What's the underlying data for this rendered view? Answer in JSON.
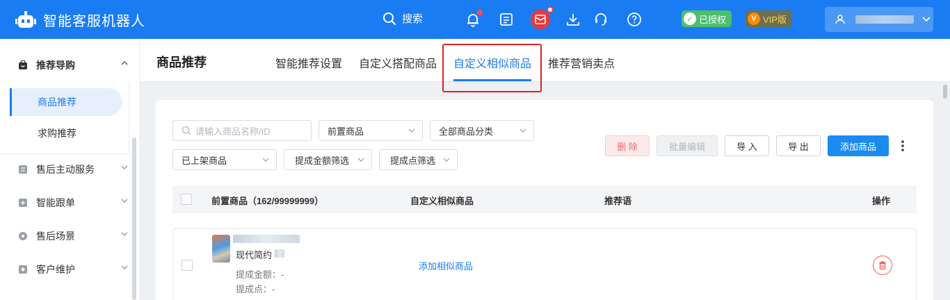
{
  "app": {
    "title": "智能客服机器人"
  },
  "topbar": {
    "search_label": "搜索",
    "authorized_label": "已授权",
    "vip_label": "VIP版",
    "icons": [
      "bell-icon",
      "note-icon",
      "gift-icon",
      "download-icon",
      "headset-icon",
      "help-icon",
      "user-icon"
    ]
  },
  "sidebar": {
    "groups": [
      {
        "label": "推荐导购",
        "expanded": true
      },
      {
        "label": "售后主动服务"
      },
      {
        "label": "智能跟单"
      },
      {
        "label": "售后场景"
      },
      {
        "label": "客户维护"
      }
    ],
    "subitems": [
      {
        "label": "商品推荐",
        "active": true
      },
      {
        "label": "求购推荐"
      }
    ]
  },
  "header": {
    "page_title": "商品推荐",
    "tabs": [
      {
        "label": "智能推荐设置"
      },
      {
        "label": "自定义搭配商品"
      },
      {
        "label": "自定义相似商品",
        "active": true
      },
      {
        "label": "推荐营销卖点"
      }
    ]
  },
  "filters": {
    "search_placeholder": "请输入商品名称/ID",
    "product_select": "前置商品",
    "category_select": "全部商品分类",
    "status_select": "已上架商品",
    "commission_amount_filter": "提成金额筛选",
    "commission_point_filter": "提成点筛选"
  },
  "actions": {
    "delete": "删 除",
    "batch_edit": "批量编辑",
    "import": "导 入",
    "export": "导 出",
    "add": "添加商品"
  },
  "table": {
    "columns": {
      "product": "前置商品（162/99999999）",
      "similar": "自定义相似商品",
      "slogan": "推荐语",
      "ops": "操作"
    },
    "rows": [
      {
        "name": "现代简约",
        "commission_amount": "提成金额：-",
        "commission_point": "提成点：-",
        "similar_link": "添加相似商品"
      }
    ]
  },
  "colors": {
    "primary": "#1a7cf2",
    "highlight": "#e02020",
    "danger": "#ee5a5a"
  }
}
